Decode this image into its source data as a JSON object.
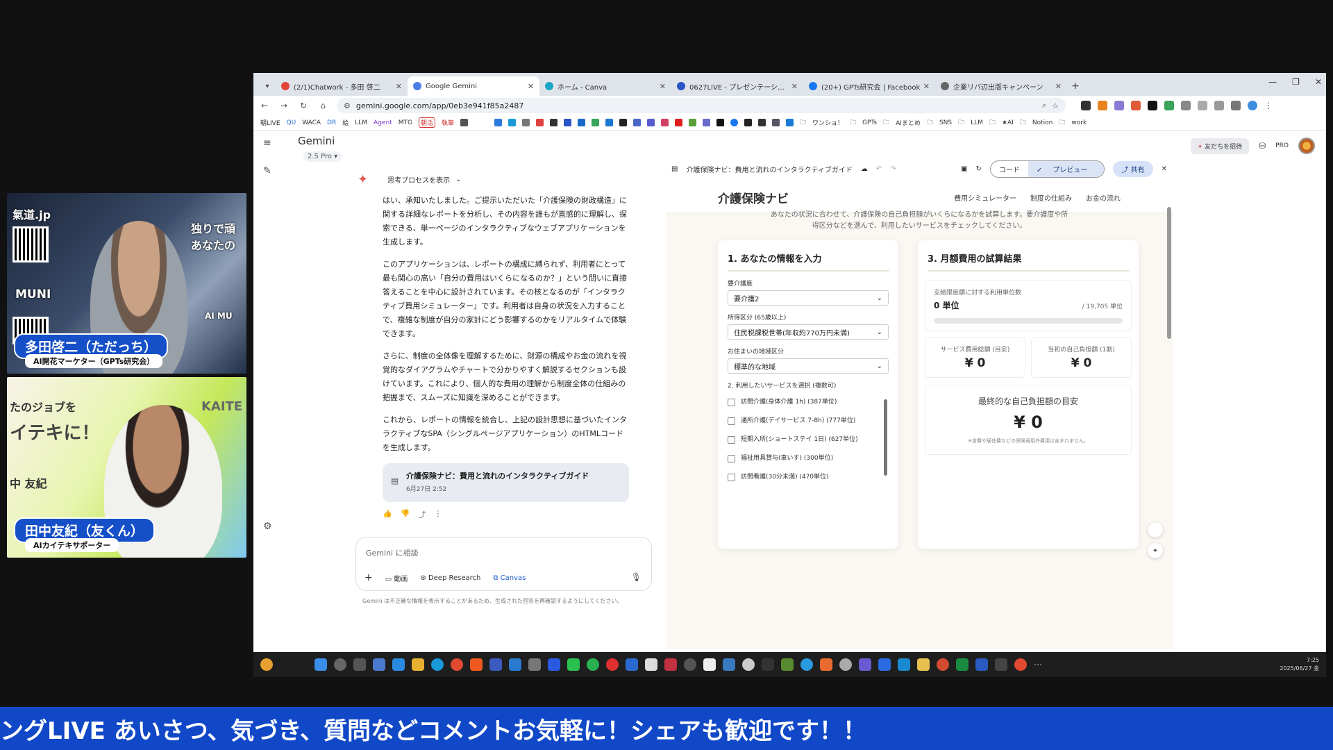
{
  "webcams": [
    {
      "overlay_top": "氣道.jp",
      "overlay_right_1": "独りで頑",
      "overlay_right_2": "あなたの",
      "overlay_mid": "MUNI",
      "overlay_mid2": "AI MU",
      "name": "多田啓二（ただっち）",
      "role": "AI開花マーケター（GPTs研究会）"
    },
    {
      "overlay_1": "たのジョブを",
      "overlay_2": "イテキに！",
      "overlay_brand": "KAITE",
      "overlay_name": "中 友紀",
      "name": "田中友紀（友くん）",
      "role": "AIカイテキサポーター"
    }
  ],
  "browser": {
    "tabs": [
      {
        "title": "(2/1)Chatwork - 多田 啓二",
        "color": "#e0463a",
        "active": false
      },
      {
        "title": "Google Gemini",
        "color": "#4a7de8",
        "active": true
      },
      {
        "title": "ホーム - Canva",
        "color": "#17a6c4",
        "active": false
      },
      {
        "title": "0627LIVE - プレゼンテーション",
        "color": "#2a55c8",
        "active": false
      },
      {
        "title": "(20+) GPTs研究会 | Facebook",
        "color": "#1877f2",
        "active": false
      },
      {
        "title": "企業リバ辺出版キャンペーン",
        "color": "#666666",
        "active": false
      }
    ],
    "url": "gemini.google.com/app/0eb3e941f85a2487",
    "bookmarks": [
      "朝LIVE",
      "QU",
      "WACA",
      "DR",
      "絵",
      "LLM",
      "Agent",
      "MTG",
      "朝活",
      "執筆"
    ],
    "bookmark_folders": [
      "ワンショ！",
      "GPTs",
      "AIまとめ",
      "SNS",
      "LLM",
      "★AI",
      "Notion",
      "work"
    ]
  },
  "gemini": {
    "title": "Gemini",
    "model": "2.5 Pro",
    "invite": "友だちを招待",
    "pro": "PRO",
    "thinking": "思考プロセスを表示",
    "paragraphs": [
      "はい、承知いたしました。ご提示いただいた「介護保険の財政構造」に関する詳細なレポートを分析し、その内容を誰もが直感的に理解し、探索できる、単一ページのインタラクティブなウェブアプリケーションを生成します。",
      "このアプリケーションは、レポートの構成に縛られず、利用者にとって最も関心の高い「自分の費用はいくらになるのか？」という問いに直接答えることを中心に設計されています。その核となるのが「インタラクティブ費用シミュレーター」です。利用者は自身の状況を入力することで、複雑な制度が自分の家計にどう影響するのかをリアルタイムで体験できます。",
      "さらに、制度の全体像を理解するために、財源の構成やお金の流れを視覚的なダイアグラムやチャートで分かりやすく解説するセクションも設けています。これにより、個人的な費用の理解から制度全体の仕組みの把握まで、スムーズに知識を深めることができます。",
      "これから、レポートの情報を統合し、上記の設計思想に基づいたインタラクティブなSPA（シングルページアプリケーション）のHTMLコードを生成します。"
    ],
    "doc_card": {
      "title": "介護保険ナビ：費用と流れのインタラクティブガイド",
      "date": "6月27日 2:52"
    },
    "composer_placeholder": "Gemini に相談",
    "tools": {
      "video": "動画",
      "deep": "Deep Research",
      "canvas": "Canvas"
    },
    "disclaimer": "Gemini は不正確な情報を表示することがあるため、生成された回答を再確認するようにしてください。"
  },
  "canvas": {
    "title": "介護保険ナビ：費用と流れのインタラクティブガイド",
    "code_label": "コード",
    "preview_label": "プレビュー",
    "share_label": "共有",
    "site": {
      "brand": "介護保険ナビ",
      "nav": [
        "費用シミュレーター",
        "制度の仕組み",
        "お金の流れ"
      ],
      "intro_1": "あなたの状況に合わせて、介護保険の自己負担額がいくらになるかを試算します。要介護度や所",
      "intro_2": "得区分などを選んで、利用したいサービスをチェックしてください。",
      "input_card": {
        "heading": "1. あなたの情報を入力",
        "care_level_label": "要介護度",
        "care_level_value": "要介護2",
        "income_label": "所得区分 (65歳以上)",
        "income_value": "住民税課税世帯(年収約770万円未満)",
        "region_label": "お住まいの地域区分",
        "region_value": "標準的な地域",
        "services_label": "2. 利用したいサービスを選択 (複数可)",
        "services": [
          "訪問介護(身体介護 1h) (387単位)",
          "通所介護(デイサービス 7-8h) (777単位)",
          "短期入所(ショートステイ 1日) (627単位)",
          "福祉用具貸与(車いす) (300単位)",
          "訪問看護(30分未満) (470単位)"
        ]
      },
      "result_card": {
        "heading": "3. 月額費用の試算結果",
        "limit_label": "支給限度額に対する利用単位数",
        "units_used": "0 単位",
        "units_limit": "/ 19,705 単位",
        "usage_fraction": 0,
        "total_label": "サービス費用総額 (目安)",
        "total_value": "¥ 0",
        "self_label": "当初の自己負担額 (1割)",
        "self_value": "¥ 0",
        "final_label": "最終的な自己負担額の目安",
        "final_value": "¥ 0",
        "final_note": "※食費や居住費などの保険適用外費用は含まれません。"
      }
    }
  },
  "taskbar": {
    "time": "7:25",
    "date": "2025/06/27 金"
  },
  "ticker": "ングLIVE あいさつ、気づき、質問などコメントお気軽に！シェアも歓迎です！！"
}
